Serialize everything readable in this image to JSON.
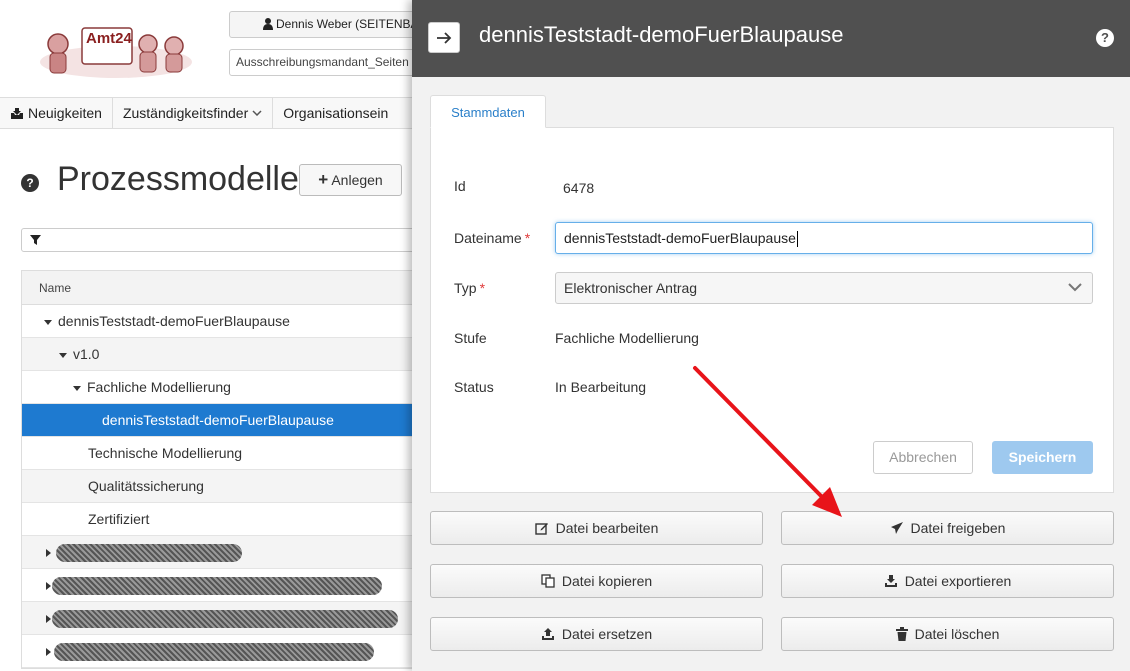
{
  "header": {
    "logo_text": "Amt24",
    "user_label": "Dennis Weber (SEITENBA",
    "mandant_value": "Ausschreibungsmandant_Seiten"
  },
  "nav": {
    "items": [
      {
        "label": "Neuigkeiten",
        "icon": "inbox-icon"
      },
      {
        "label": "Zuständigkeitsfinder",
        "icon": "chevron-down-icon"
      },
      {
        "label": "Organisationsein",
        "icon": ""
      }
    ]
  },
  "page": {
    "title": "Prozessmodelle",
    "create_label": "Anlegen"
  },
  "tree": {
    "column_header": "Name",
    "rows": [
      {
        "label": "dennisTeststadt-demoFuerBlaupause",
        "level": 0,
        "expanded": true
      },
      {
        "label": "v1.0",
        "level": 1,
        "expanded": true
      },
      {
        "label": "Fachliche Modellierung",
        "level": 2,
        "expanded": true
      },
      {
        "label": "dennisTeststadt-demoFuerBlaupause",
        "level": 3,
        "selected": true
      },
      {
        "label": "Technische Modellierung",
        "level": 2
      },
      {
        "label": "Qualitätssicherung",
        "level": 2
      },
      {
        "label": "Zertifiziert",
        "level": 2
      }
    ]
  },
  "panel": {
    "title": "dennisTeststadt-demoFuerBlaupause",
    "tab_label": "Stammdaten",
    "fields": {
      "id_label": "Id",
      "id_value": "6478",
      "dateiname_label": "Dateiname",
      "dateiname_value": "dennisTeststadt-demoFuerBlaupause",
      "typ_label": "Typ",
      "typ_value": "Elektronischer Antrag",
      "stufe_label": "Stufe",
      "stufe_value": "Fachliche Modellierung",
      "status_label": "Status",
      "status_value": "In Bearbeitung",
      "required_mark": "*"
    },
    "cancel_label": "Abbrechen",
    "save_label": "Speichern",
    "actions": {
      "edit": "Datei bearbeiten",
      "release": "Datei freigeben",
      "copy": "Datei kopieren",
      "export": "Datei exportieren",
      "replace": "Datei ersetzen",
      "delete": "Datei löschen"
    }
  },
  "colors": {
    "panel_header": "#505050",
    "selection": "#1e7ad0",
    "annotation_arrow": "#e8141a",
    "save_disabled": "#9ec9ef"
  }
}
